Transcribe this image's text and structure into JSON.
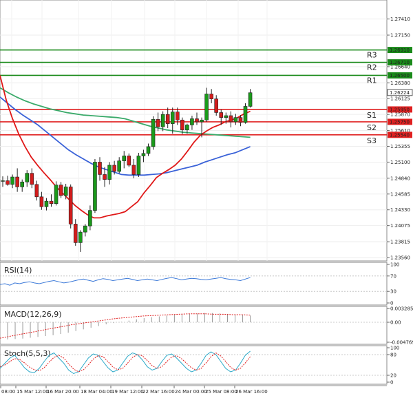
{
  "chart_data": {
    "type": "candlestick",
    "price_axis": {
      "min": 1.2356,
      "max": 1.2765,
      "ticks": [
        "1.27410",
        "1.27150",
        "1.26640",
        "1.26380",
        "1.26125",
        "1.25870",
        "1.25610",
        "1.25355",
        "1.25100",
        "1.24840",
        "1.24585",
        "1.24330",
        "1.24075",
        "1.23815",
        "1.23560"
      ]
    },
    "levels": [
      {
        "name": "R3",
        "value": 1.2691,
        "label": "1.26910",
        "color": "#1a8a1a"
      },
      {
        "name": "R2",
        "value": 1.2671,
        "label": "1.26710",
        "color": "#1a8a1a"
      },
      {
        "name": "R1",
        "value": 1.265,
        "label": "1.26500",
        "color": "#1a8a1a"
      },
      {
        "name": "S1",
        "value": 1.2595,
        "label": "1.25950",
        "color": "#e02020"
      },
      {
        "name": "S2",
        "value": 1.2575,
        "label": "1.25750",
        "color": "#e02020"
      },
      {
        "name": "S3",
        "value": 1.2554,
        "label": "1.25540",
        "color": "#e02020"
      }
    ],
    "current_price": {
      "value": 1.26224,
      "label": "1.26224"
    },
    "time_labels": [
      "08:00",
      "15 Mar 12:00",
      "16 Mar 20:00",
      "18 Mar 04:00",
      "19 Mar 12:00",
      "22 Mar 16:00",
      "24 Mar 00:00",
      "25 Mar 08:00",
      "26 Mar 16:00"
    ],
    "candles": [
      [
        1.2479,
        1.2487,
        1.247,
        1.248
      ],
      [
        1.248,
        1.2488,
        1.2472,
        1.2474
      ],
      [
        1.2474,
        1.249,
        1.2468,
        1.2486
      ],
      [
        1.2486,
        1.25,
        1.2462,
        1.247
      ],
      [
        1.247,
        1.2482,
        1.2462,
        1.2478
      ],
      [
        1.2478,
        1.2497,
        1.247,
        1.2492
      ],
      [
        1.2492,
        1.25,
        1.2468,
        1.2474
      ],
      [
        1.2474,
        1.248,
        1.2448,
        1.2454
      ],
      [
        1.2454,
        1.2462,
        1.2433,
        1.2438
      ],
      [
        1.2438,
        1.2452,
        1.2432,
        1.2447
      ],
      [
        1.2447,
        1.2458,
        1.2438,
        1.2443
      ],
      [
        1.2443,
        1.2479,
        1.244,
        1.2473
      ],
      [
        1.2473,
        1.2478,
        1.2452,
        1.2456
      ],
      [
        1.2456,
        1.2475,
        1.245,
        1.247
      ],
      [
        1.247,
        1.2474,
        1.2403,
        1.241
      ],
      [
        1.241,
        1.2418,
        1.2375,
        1.238
      ],
      [
        1.238,
        1.24,
        1.2365,
        1.2397
      ],
      [
        1.2397,
        1.241,
        1.239,
        1.2407
      ],
      [
        1.2407,
        1.244,
        1.24,
        1.2432
      ],
      [
        1.2432,
        1.2515,
        1.2428,
        1.251
      ],
      [
        1.251,
        1.2518,
        1.248,
        1.249
      ],
      [
        1.249,
        1.2502,
        1.247,
        1.2482
      ],
      [
        1.2482,
        1.251,
        1.2474,
        1.2505
      ],
      [
        1.2505,
        1.2512,
        1.249,
        1.2495
      ],
      [
        1.2495,
        1.2518,
        1.2492,
        1.2512
      ],
      [
        1.2512,
        1.2528,
        1.25,
        1.252
      ],
      [
        1.252,
        1.2524,
        1.2502,
        1.2505
      ],
      [
        1.2505,
        1.2515,
        1.2484,
        1.249
      ],
      [
        1.249,
        1.2525,
        1.2486,
        1.252
      ],
      [
        1.252,
        1.253,
        1.251,
        1.2524
      ],
      [
        1.2524,
        1.254,
        1.252,
        1.2535
      ],
      [
        1.2535,
        1.2584,
        1.253,
        1.2579
      ],
      [
        1.2579,
        1.259,
        1.256,
        1.2567
      ],
      [
        1.2567,
        1.2592,
        1.256,
        1.2587
      ],
      [
        1.2587,
        1.2598,
        1.2565,
        1.2572
      ],
      [
        1.2572,
        1.2598,
        1.2556,
        1.2591
      ],
      [
        1.2591,
        1.2598,
        1.257,
        1.2578
      ],
      [
        1.2578,
        1.2582,
        1.2555,
        1.2562
      ],
      [
        1.2562,
        1.2572,
        1.2556,
        1.257
      ],
      [
        1.257,
        1.2585,
        1.2562,
        1.258
      ],
      [
        1.258,
        1.259,
        1.257,
        1.2575
      ],
      [
        1.2575,
        1.2582,
        1.255,
        1.2578
      ],
      [
        1.2578,
        1.263,
        1.2575,
        1.262
      ],
      [
        1.262,
        1.2628,
        1.2605,
        1.2612
      ],
      [
        1.2612,
        1.2618,
        1.2585,
        1.259
      ],
      [
        1.259,
        1.2595,
        1.257,
        1.2582
      ],
      [
        1.2582,
        1.259,
        1.2572,
        1.2585
      ],
      [
        1.2585,
        1.2592,
        1.2566,
        1.2575
      ],
      [
        1.2575,
        1.2588,
        1.257,
        1.2582
      ],
      [
        1.2582,
        1.2586,
        1.2568,
        1.2574
      ],
      [
        1.2574,
        1.2605,
        1.2572,
        1.26
      ],
      [
        1.26,
        1.2628,
        1.2598,
        1.2622
      ]
    ],
    "sma_red": [
      1.265,
      1.261,
      1.258,
      1.2555,
      1.2535,
      1.2518,
      1.2505,
      1.2493,
      1.2482,
      1.247,
      1.246,
      1.245,
      1.244,
      1.2432,
      1.2425,
      1.242,
      1.242,
      1.2423,
      1.2425,
      1.2427,
      1.243,
      1.2438,
      1.2446,
      1.246,
      1.2472,
      1.2485,
      1.2492,
      1.2498,
      1.2505,
      1.2515,
      1.2528,
      1.2542,
      1.2553,
      1.256,
      1.2566,
      1.257,
      1.2575,
      1.2578,
      1.2582,
      1.2588,
      1.2592
    ],
    "sma_blue": [
      1.2615,
      1.2605,
      1.2595,
      1.2586,
      1.2578,
      1.257,
      1.256,
      1.255,
      1.254,
      1.253,
      1.2522,
      1.2515,
      1.2508,
      1.2502,
      1.2498,
      1.2494,
      1.249,
      1.2489,
      1.2489,
      1.2489,
      1.249,
      1.2491,
      1.2493,
      1.2496,
      1.2499,
      1.2502,
      1.2505,
      1.251,
      1.2514,
      1.2518,
      1.2522,
      1.2525,
      1.253,
      1.2535
    ],
    "sma_green": [
      1.263,
      1.2622,
      1.2615,
      1.2609,
      1.2604,
      1.26,
      1.2596,
      1.2593,
      1.259,
      1.2588,
      1.2586,
      1.2585,
      1.2584,
      1.2583,
      1.2582,
      1.258,
      1.2576,
      1.2572,
      1.2568,
      1.2565,
      1.2562,
      1.256,
      1.2558,
      1.2557,
      1.2556,
      1.2555,
      1.2554,
      1.2553,
      1.2552,
      1.2551,
      1.255
    ],
    "indicators": [
      {
        "name": "RSI(14)",
        "axis": [
          "100",
          "70",
          "30",
          "0"
        ],
        "range": [
          0,
          100
        ],
        "color": "#3a78d8",
        "values": [
          48,
          50,
          46,
          52,
          50,
          53,
          55,
          52,
          50,
          53,
          56,
          58,
          55,
          52,
          54,
          57,
          60,
          62,
          59,
          56,
          60,
          63,
          61,
          58,
          60,
          62,
          64,
          61,
          58,
          60,
          62,
          60,
          58,
          61,
          64,
          66,
          63,
          60,
          62,
          64,
          63,
          61,
          60,
          62,
          64,
          66,
          63,
          61,
          60,
          58,
          62,
          66
        ]
      },
      {
        "name": "MACD(12,26,9)",
        "axis": [
          "0.003285",
          "0.00",
          "-0.004769"
        ],
        "range": [
          -0.004769,
          0.003285
        ],
        "color": "#e02020",
        "histogram": [
          -0.0042,
          -0.0041,
          -0.004,
          -0.0039,
          -0.0037,
          -0.0035,
          -0.0033,
          -0.0031,
          -0.0028,
          -0.0025,
          -0.0021,
          -0.0017,
          -0.0013,
          -0.0009,
          -0.0005,
          -0.0002,
          0.0001,
          0.0004,
          0.0007,
          0.001,
          0.0012,
          0.0014,
          0.0016,
          0.0018,
          0.0019,
          0.002,
          0.0021,
          0.0022,
          0.0022,
          0.0021,
          0.002,
          0.0019,
          0.0018,
          0.0016
        ],
        "signal": [
          -0.0038,
          -0.0034,
          -0.003,
          -0.0026,
          -0.0022,
          -0.0018,
          -0.0014,
          -0.001,
          -0.0006,
          -0.0003,
          0.0,
          0.0003,
          0.0006,
          0.0009,
          0.0011,
          0.0013,
          0.0015,
          0.0016,
          0.0017,
          0.0018,
          0.0019,
          0.002,
          0.002,
          0.002,
          0.0019,
          0.0019,
          0.0018,
          0.0018,
          0.0017
        ]
      },
      {
        "name": "Stoch(5,5,3)",
        "axis": [
          "100",
          "80",
          "20",
          "0"
        ],
        "range": [
          0,
          100
        ],
        "color": "#2aa8c8",
        "k": [
          40,
          55,
          70,
          78,
          60,
          42,
          30,
          28,
          40,
          60,
          78,
          85,
          70,
          55,
          35,
          25,
          30,
          50,
          70,
          82,
          78,
          60,
          42,
          30,
          35,
          55,
          75,
          85,
          80,
          65,
          45,
          35,
          40,
          60,
          78,
          82,
          70,
          55,
          40,
          30,
          35,
          55,
          78,
          88,
          80,
          60,
          40,
          30,
          35,
          55,
          78,
          90
        ],
        "d": [
          45,
          50,
          60,
          68,
          66,
          56,
          44,
          36,
          33,
          42,
          58,
          72,
          78,
          70,
          53,
          38,
          30,
          36,
          50,
          67,
          77,
          74,
          60,
          44,
          36,
          40,
          55,
          72,
          80,
          77,
          63,
          48,
          40,
          45,
          60,
          73,
          77,
          68,
          55,
          42,
          35,
          40,
          56,
          74,
          85,
          76,
          60,
          43,
          35,
          40,
          56,
          74
        ]
      }
    ]
  }
}
